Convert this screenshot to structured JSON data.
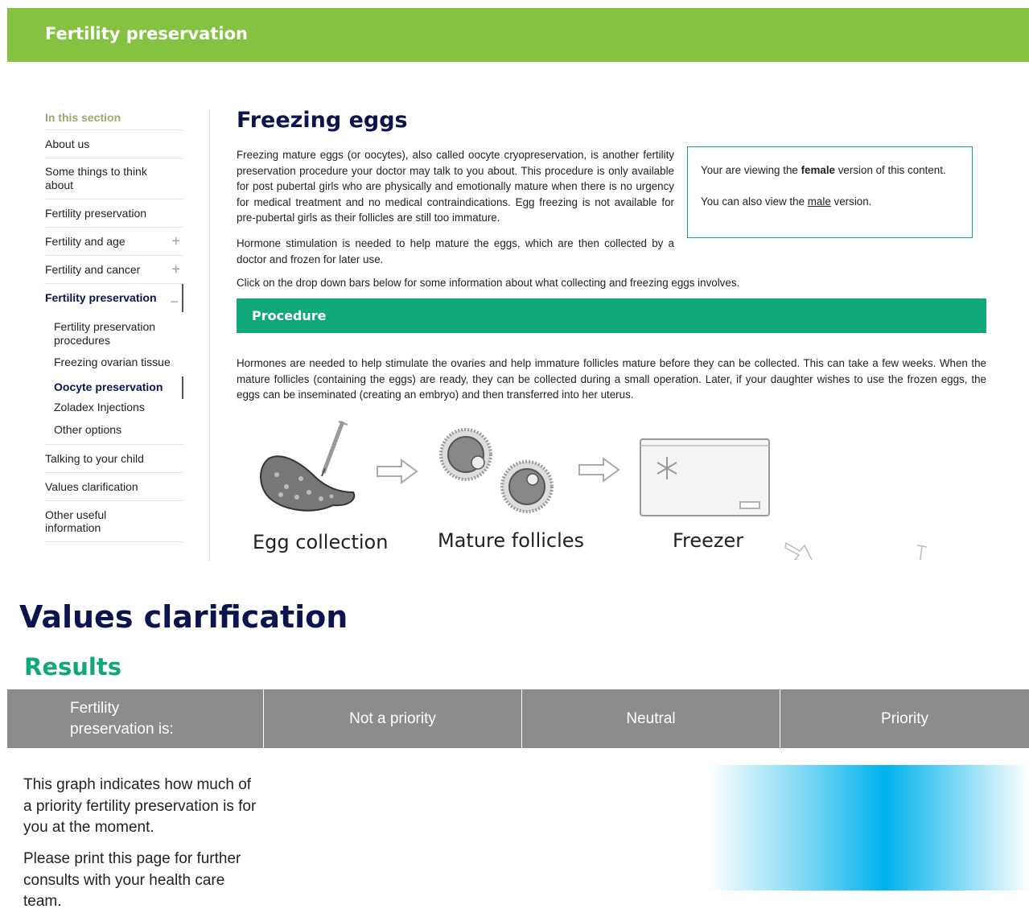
{
  "banner": {
    "title": "Fertility preservation"
  },
  "sidebar": {
    "heading": "In this section",
    "items": [
      {
        "label": "About us",
        "expand": ""
      },
      {
        "label": "Some things to think about",
        "expand": ""
      },
      {
        "label": "Fertility preservation",
        "expand": ""
      },
      {
        "label": "Fertility and age",
        "expand": "+"
      },
      {
        "label": "Fertility and cancer",
        "expand": "+"
      },
      {
        "label": "Fertility preservation",
        "expand": "−"
      }
    ],
    "subitems": [
      "Fertility preservation procedures",
      "Freezing ovarian tissue",
      "Oocyte preservation",
      "Zoladex Injections",
      "Other options"
    ],
    "items_after": [
      "Talking to your child",
      "Values clarification",
      "Other useful information"
    ]
  },
  "main": {
    "title": "Freezing eggs",
    "para1": "Freezing mature eggs (or oocytes), also called oocyte cryopreservation, is another fertility preservation procedure your doctor may talk to you about. This procedure is only available for post pubertal girls who are physically and emotionally mature when there is no urgency for medical treatment and no medical contraindications. Egg freezing is not available for pre-pubertal girls as their follicles are still too immature.",
    "para2": "Hormone stimulation is needed to help mature the eggs, which are then collected by a doctor and frozen for later use.",
    "para3": "Click on the drop down bars below for some information about what collecting and freezing eggs involves.",
    "infobox": {
      "line1_pre": "Your are viewing the ",
      "line1_bold": "female",
      "line1_post": " version of this content.",
      "line2_pre": "You can also view the ",
      "line2_link": "male",
      "line2_post": " version."
    },
    "procedure": {
      "label": "Procedure",
      "text": "Hormones are needed to help stimulate the ovaries and help immature follicles mature before they can be collected. This can take a few weeks. When the mature follicles (containing the eggs) are ready, they can be collected during a small operation. Later, if your daughter wishes to use the frozen eggs, the eggs can be inseminated (creating an embryo) and then transferred into her uterus."
    },
    "illustration": {
      "labels": [
        "Egg collection",
        "Mature follicles",
        "Freezer"
      ],
      "icons": [
        "ovary-syringe-icon",
        "follicle-icon",
        "freezer-icon",
        "snowflake-icon",
        "arrow-icon"
      ]
    }
  },
  "values": {
    "title": "Values clarification",
    "results_title": "Results",
    "table": {
      "col0_line1": "Fertility",
      "col0_line2": "preservation is:",
      "col1": "Not a priority",
      "col2": "Neutral",
      "col3": "Priority"
    },
    "desc1": "This graph indicates how much of a priority fertility preservation is for you at the moment.",
    "desc2": "Please print this page for further consults with your health care team.",
    "result_level": "Priority",
    "colors": {
      "bar": "#00b2ec",
      "header": "#8c8c8c",
      "accent": "#10a77b",
      "banner": "#85c241",
      "navy": "#0c1450"
    }
  }
}
